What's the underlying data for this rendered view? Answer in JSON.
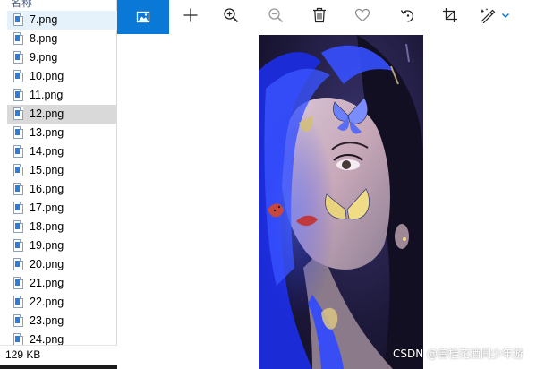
{
  "explorer": {
    "column_header": "名称",
    "files": [
      {
        "name": "7.png",
        "state": "hover"
      },
      {
        "name": "8.png",
        "state": ""
      },
      {
        "name": "9.png",
        "state": ""
      },
      {
        "name": "10.png",
        "state": ""
      },
      {
        "name": "11.png",
        "state": ""
      },
      {
        "name": "12.png",
        "state": "selected"
      },
      {
        "name": "13.png",
        "state": ""
      },
      {
        "name": "14.png",
        "state": ""
      },
      {
        "name": "15.png",
        "state": ""
      },
      {
        "name": "16.png",
        "state": ""
      },
      {
        "name": "17.png",
        "state": ""
      },
      {
        "name": "18.png",
        "state": ""
      },
      {
        "name": "19.png",
        "state": ""
      },
      {
        "name": "20.png",
        "state": ""
      },
      {
        "name": "21.png",
        "state": ""
      },
      {
        "name": "22.png",
        "state": ""
      },
      {
        "name": "23.png",
        "state": ""
      },
      {
        "name": "24.png",
        "state": ""
      }
    ],
    "status_size": "129 KB"
  },
  "viewer": {
    "toolbar": {
      "accent_color": "#0a78d7",
      "tools": [
        {
          "icon": "gallery-icon"
        },
        {
          "icon": "add-icon"
        },
        {
          "icon": "zoom-in-icon"
        },
        {
          "icon": "zoom-out-icon"
        },
        {
          "icon": "delete-icon"
        },
        {
          "icon": "favorite-icon"
        },
        {
          "icon": "rotate-icon"
        },
        {
          "icon": "crop-icon"
        },
        {
          "icon": "edit-icon"
        }
      ]
    },
    "watermark": "CSDN @曾桂花酒同少年游"
  }
}
